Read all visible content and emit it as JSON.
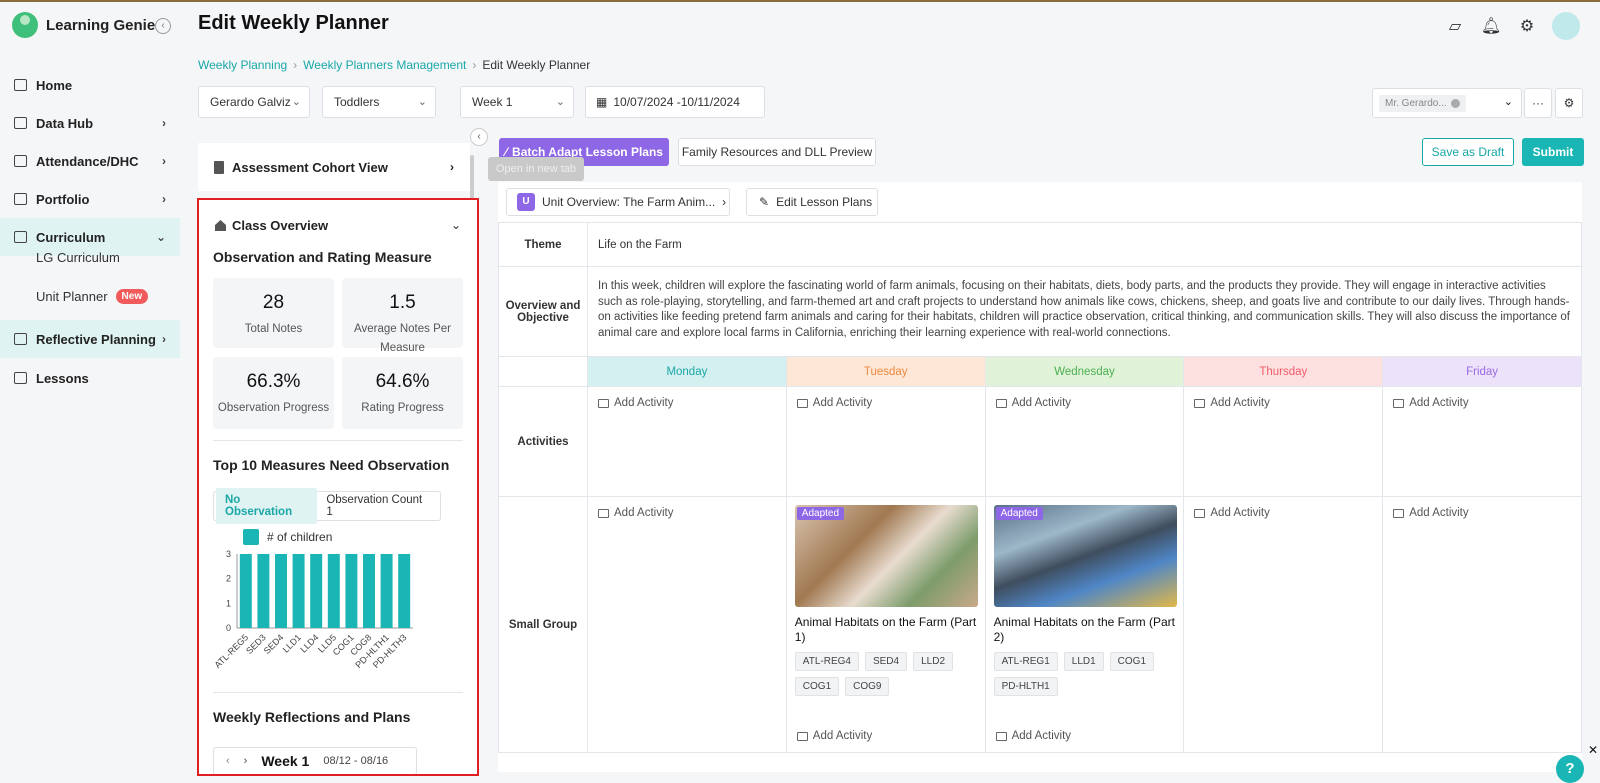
{
  "app": {
    "name": "Learning Genie"
  },
  "header": {
    "title": "Edit Weekly Planner"
  },
  "sidebar": {
    "items": [
      {
        "label": "Home"
      },
      {
        "label": "Data Hub"
      },
      {
        "label": "Attendance/DHC"
      },
      {
        "label": "Portfolio"
      },
      {
        "label": "Curriculum"
      },
      {
        "label": "Reflective Planning"
      },
      {
        "label": "Lessons"
      }
    ],
    "sub_items": [
      {
        "label": "LG Curriculum"
      },
      {
        "label": "Unit Planner",
        "badge": "New"
      }
    ]
  },
  "breadcrumb": [
    "Weekly Planning",
    "Weekly Planners Management",
    "Edit Weekly Planner"
  ],
  "filters": {
    "teacher": "Gerardo Galviz",
    "group": "Toddlers",
    "week": "Week 1",
    "date_range": "10/07/2024 -10/11/2024",
    "assignee": "Mr. Gerardo..."
  },
  "left_panel": {
    "cohort_title": "Assessment Cohort View",
    "class_title": "Class Overview",
    "obs_title": "Observation and Rating Measure",
    "stats": [
      {
        "value": "28",
        "label": "Total Notes"
      },
      {
        "value": "1.5",
        "label": "Average Notes Per Measure"
      },
      {
        "value": "66.3%",
        "label": "Observation Progress"
      },
      {
        "value": "64.6%",
        "label": "Rating Progress"
      }
    ],
    "top_measures_title": "Top 10 Measures Need Observation",
    "tabs": [
      "No Observation",
      "Observation Count 1"
    ],
    "legend": "# of children",
    "reflections_title": "Weekly Reflections and Plans",
    "week_label": "Week 1",
    "week_dates": "08/12 - 08/16"
  },
  "chart_data": {
    "type": "bar",
    "categories": [
      "ATL-REG5",
      "SED3",
      "SED4",
      "LLD1",
      "LLD4",
      "LLD5",
      "COG1",
      "COG8",
      "PD-HLTH1",
      "PD-HLTH3"
    ],
    "series": [
      {
        "name": "# of children",
        "values": [
          3,
          3,
          3,
          3,
          3,
          3,
          3,
          3,
          3,
          3
        ]
      }
    ],
    "ylim": [
      0,
      3
    ],
    "yticks": [
      0,
      1,
      2,
      3
    ],
    "color": "#1ab5b5"
  },
  "toolbar": {
    "batch_label": "Batch Adapt Lesson Plans",
    "tooltip": "Open in new tab",
    "family_label": "Family Resources and DLL Preview",
    "draft_label": "Save as Draft",
    "submit_label": "Submit"
  },
  "planner": {
    "unit_label": "Unit Overview: The Farm Anim...",
    "edit_label": "Edit Lesson Plans",
    "theme_label": "Theme",
    "theme_value": "Life on the Farm",
    "overview_label": "Overview and Objective",
    "overview_text": "In this week, children will explore the fascinating world of farm animals, focusing on their habitats, diets, body parts, and the products they provide. They will engage in interactive activities such as role-playing, storytelling, and farm-themed art and craft projects to understand how animals like cows, chickens, sheep, and goats live and contribute to our daily lives. Through hands-on activities like feeding pretend farm animals and caring for their habitats, children will practice observation, critical thinking, and communication skills. They will also discuss the importance of animal care and explore local farms in California, enriching their learning experience with real-world connections.",
    "days": [
      {
        "name": "Monday",
        "bg": "#d5f0f0",
        "color": "#1aa7a7"
      },
      {
        "name": "Tuesday",
        "bg": "#fde7d6",
        "color": "#f08a3e"
      },
      {
        "name": "Wednesday",
        "bg": "#e0f3d8",
        "color": "#4caf50"
      },
      {
        "name": "Thursday",
        "bg": "#fde0e0",
        "color": "#f25c6a"
      },
      {
        "name": "Friday",
        "bg": "#ece2f9",
        "color": "#9b6be0"
      }
    ],
    "activities_label": "Activities",
    "small_group_label": "Small Group",
    "add_activity": "Add Activity",
    "adapted": "Adapted",
    "lessons": [
      {
        "title": "Animal Habitats on the Farm (Part 1)",
        "tags": [
          "ATL-REG4",
          "SED4",
          "LLD2",
          "COG1",
          "COG9"
        ]
      },
      {
        "title": "Animal Habitats on the Farm (Part 2)",
        "tags": [
          "ATL-REG1",
          "LLD1",
          "COG1",
          "PD-HLTH1"
        ]
      }
    ]
  },
  "help": "?"
}
